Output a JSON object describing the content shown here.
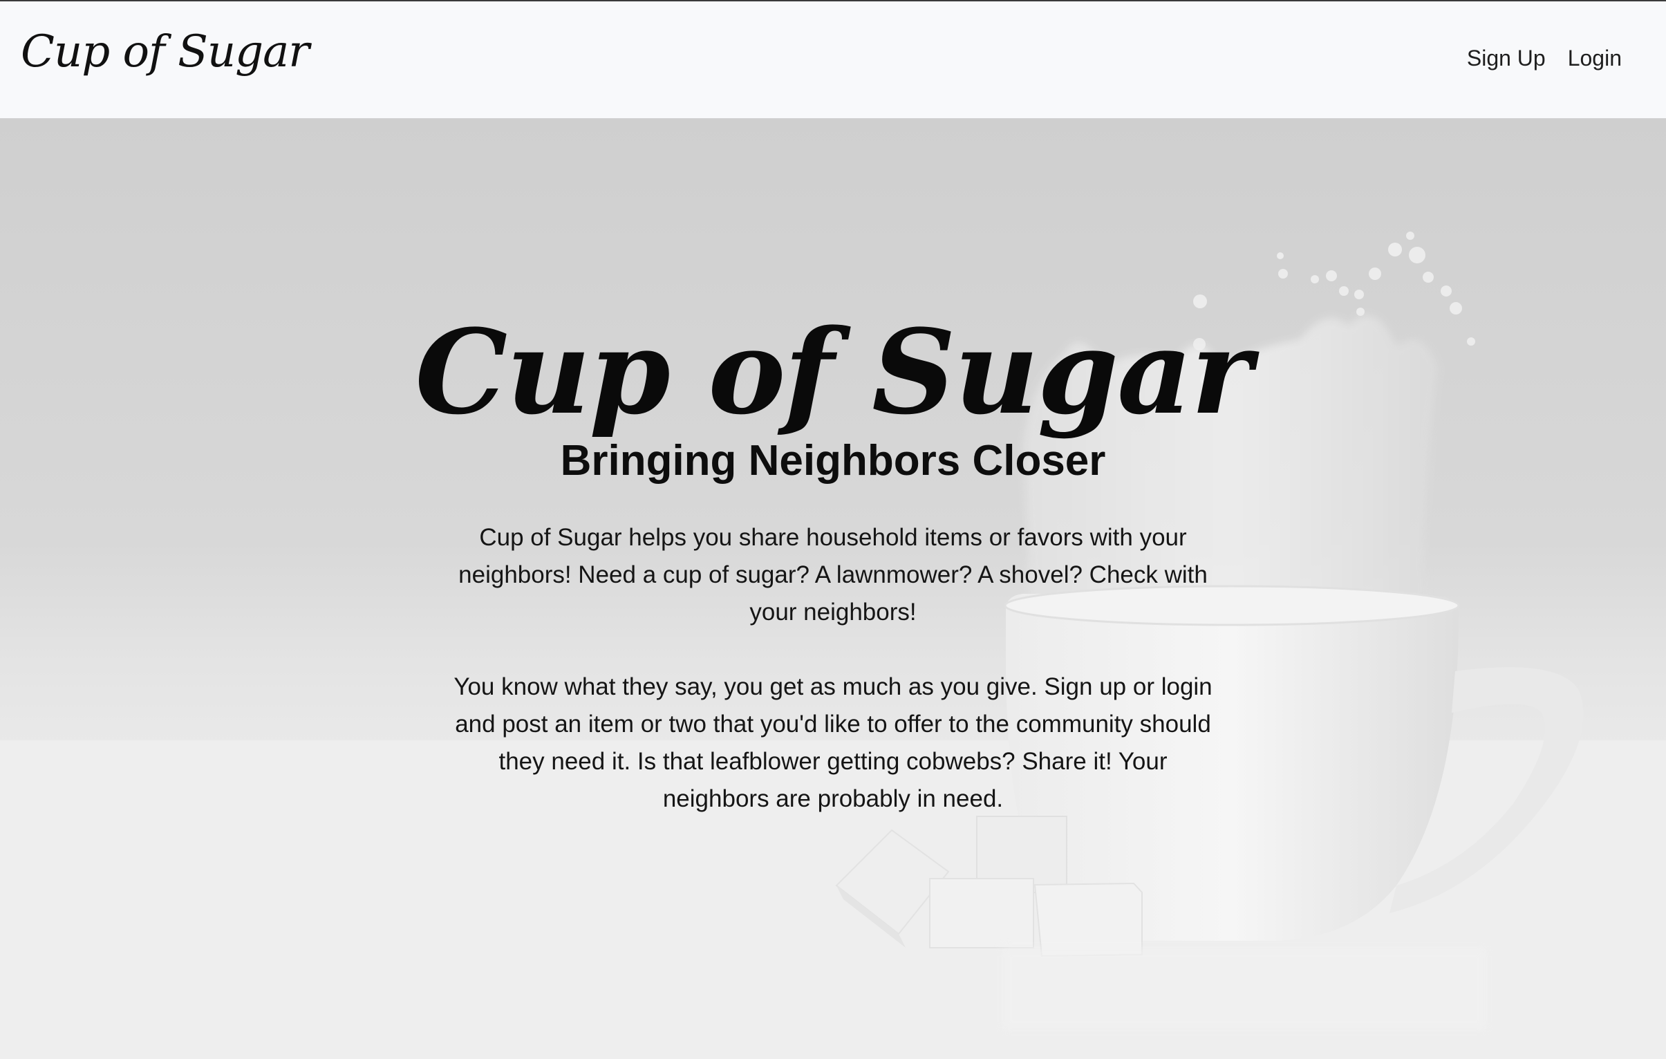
{
  "navbar": {
    "brand": "Cup of Sugar",
    "links": [
      "Sign Up",
      "Login"
    ]
  },
  "hero": {
    "title": "Cup of Sugar",
    "subtitle": "Bringing Neighbors Closer",
    "paragraphs": [
      "Cup of Sugar helps you share household items or favors with your neighbors! Need a cup of sugar? A lawnmower? A shovel? Check with your neighbors!",
      "You know what they say, you get as much as you give. Sign up or login and post an item or two that you'd like to offer to the community should they need it. Is that leafblower getting cobwebs? Share it! Your neighbors are probably in need."
    ]
  }
}
